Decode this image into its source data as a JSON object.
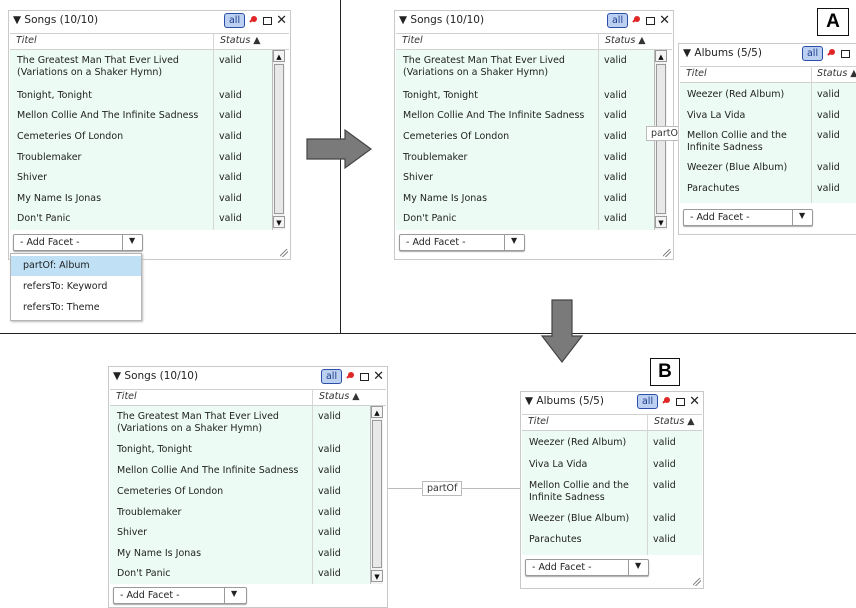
{
  "songs_panel": {
    "title": "▼ Songs (10/10)",
    "all_label": "all",
    "col_title": "Titel",
    "col_status": "Status ▲",
    "rows": [
      {
        "title": "The Greatest Man That Ever Lived (Variations on a Shaker Hymn)",
        "status": "valid"
      },
      {
        "title": "Tonight, Tonight",
        "status": "valid"
      },
      {
        "title": "Mellon Collie And The Infinite Sadness",
        "status": "valid"
      },
      {
        "title": "Cemeteries Of London",
        "status": "valid"
      },
      {
        "title": "Troublemaker",
        "status": "valid"
      },
      {
        "title": "Shiver",
        "status": "valid"
      },
      {
        "title": "My Name Is Jonas",
        "status": "valid"
      },
      {
        "title": "Don't Panic",
        "status": "valid"
      }
    ],
    "add_facet": "- Add Facet -"
  },
  "albums_panel": {
    "title": "▼ Albums (5/5)",
    "all_label": "all",
    "col_title": "Titel",
    "col_status": "Status ▲",
    "rows": [
      {
        "title": "Weezer (Red Album)",
        "status": "valid"
      },
      {
        "title": "Viva La Vida",
        "status": "valid"
      },
      {
        "title": "Mellon Collie and the Infinite Sadness",
        "status": "valid"
      },
      {
        "title": "Weezer (Blue Album)",
        "status": "valid"
      },
      {
        "title": "Parachutes",
        "status": "valid"
      }
    ],
    "add_facet": "- Add Facet -"
  },
  "facet_menu": [
    "partOf: Album",
    "refersTo: Keyword",
    "refersTo: Theme"
  ],
  "relation_label": "partOf",
  "badge_a": "A",
  "badge_b": "B",
  "colors": {
    "table_bg": "#ecfbf4",
    "menu_highlight": "#bfe0f5",
    "all_button": "#bcd0f2",
    "pin": "#e02626"
  },
  "icons": [
    "pin-icon",
    "maximize-icon",
    "close-icon",
    "dropdown-arrow-icon",
    "resize-grip-icon",
    "scroll-up-icon",
    "scroll-down-icon"
  ]
}
